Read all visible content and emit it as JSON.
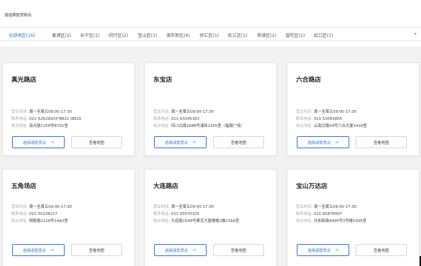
{
  "page": {
    "title": "请选择提货网点"
  },
  "filters": [
    {
      "label": "全部地区(16)",
      "active": true
    },
    {
      "label": "黄浦区(2)",
      "active": false
    },
    {
      "label": "长宁区(1)",
      "active": false
    },
    {
      "label": "闵行区(2)",
      "active": false
    },
    {
      "label": "宝山区(1)",
      "active": false
    },
    {
      "label": "浦东新区(4)",
      "active": false
    },
    {
      "label": "徐汇区(1)",
      "active": false
    },
    {
      "label": "松江区(1)",
      "active": false
    },
    {
      "label": "杨浦区(2)",
      "active": false
    },
    {
      "label": "普陀区(1)",
      "active": false
    },
    {
      "label": "虹口区(1)",
      "active": false
    }
  ],
  "labels": {
    "hours": "营业时间:",
    "phone": "联系电话:",
    "address": "网点地址:",
    "select_btn": "选择该提货点",
    "map_btn": "查看地图"
  },
  "stores": [
    {
      "name": "真光路店",
      "hours": "周一至周五09:00-17:30",
      "phone": "021-52629933*8822 /8820",
      "address": "真光路1258号B701室"
    },
    {
      "name": "东宝店",
      "hours": "周一至周五09:00-17:30",
      "phone": "021-63245163",
      "address": "四川北路1688号港陆1305室（福德广场）"
    },
    {
      "name": "六合路店",
      "hours": "周一至周五09:00-17:30",
      "phone": "021-53083805",
      "address": "云南北路59号六合大厦1418室"
    },
    {
      "name": "五角场店",
      "hours": "周一至周五09:00-17:30",
      "phone": "021-55228227",
      "address": "翔殷路1128号14A2室"
    },
    {
      "name": "大连路店",
      "hours": "周一至周五09:00-17:30",
      "phone": "021-55570105",
      "address": "大连路1548号果克大厦楼楼2楼216A室"
    },
    {
      "name": "宝山万达店",
      "hours": "周一至周五09:00-17:30",
      "phone": "021-65878007",
      "address": "共和新路4995号3号楼1006室"
    }
  ]
}
